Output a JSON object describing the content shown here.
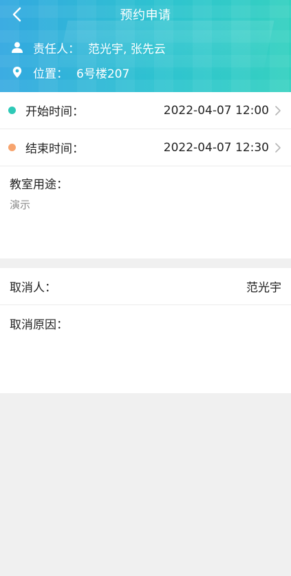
{
  "header": {
    "title": "预约申请",
    "owner_label": "责任人：",
    "owner_value": "范光宇, 张先云",
    "location_label": "位置：",
    "location_value": "6号楼207"
  },
  "times": {
    "start_label": "开始时间：",
    "start_value": "2022-04-07 12:00",
    "end_label": "结束时间：",
    "end_value": "2022-04-07 12:30"
  },
  "purpose": {
    "label": "教室用途：",
    "value": "演示"
  },
  "cancel": {
    "by_label": "取消人：",
    "by_value": "范光宇",
    "reason_label": "取消原因："
  },
  "colors": {
    "start_dot": "#2ec9b7",
    "end_dot": "#f7a46e"
  },
  "icons": {
    "back": "back-arrow-icon",
    "person": "person-icon",
    "location": "location-pin-icon",
    "chevron": "chevron-right-icon"
  }
}
